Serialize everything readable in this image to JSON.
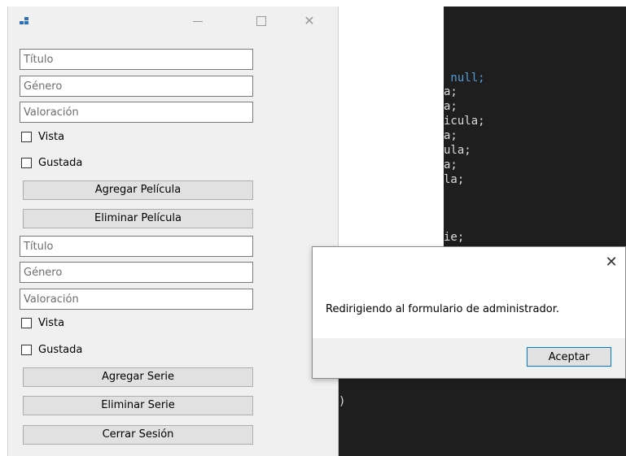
{
  "window": {
    "title": "",
    "minimize_glyph": "—",
    "close_glyph": "✕",
    "accent": "#2d6fbd"
  },
  "movies": {
    "title_placeholder": "Título",
    "genre_placeholder": "Género",
    "rating_placeholder": "Valoración",
    "watched_label": "Vista",
    "liked_label": "Gustada",
    "add_label": "Agregar Película",
    "delete_label": "Eliminar Película"
  },
  "series": {
    "title_placeholder": "Título",
    "genre_placeholder": "Género",
    "rating_placeholder": "Valoración",
    "watched_label": "Vista",
    "liked_label": "Gustada",
    "add_label": "Agregar Serie",
    "delete_label": "Eliminar Serie"
  },
  "logout_label": "Cerrar Sesión",
  "code": {
    "lines": [
      " null;",
      "a;",
      "a;",
      "icula;",
      "a;",
      "ula;",
      "a;",
      "la;",
      "ie;"
    ],
    "brace": ")"
  },
  "dialog": {
    "message": "Redirigiendo al formulario de administrador.",
    "ok_label": "Aceptar",
    "close_glyph": "✕",
    "accent": "#0078d7"
  }
}
